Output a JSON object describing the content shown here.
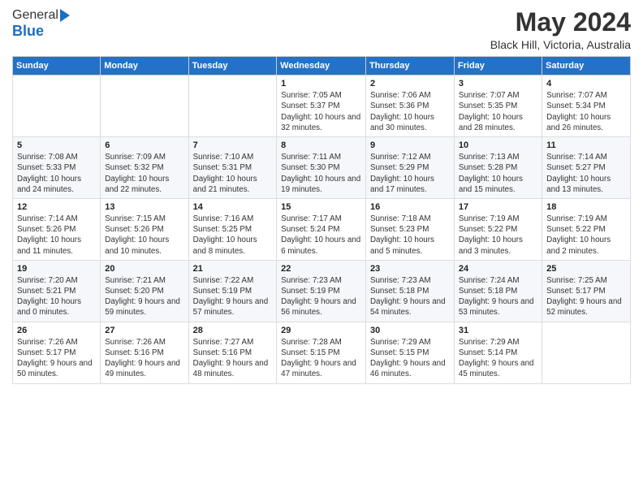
{
  "logo": {
    "general": "General",
    "blue": "Blue"
  },
  "header": {
    "month": "May 2024",
    "location": "Black Hill, Victoria, Australia"
  },
  "days_of_week": [
    "Sunday",
    "Monday",
    "Tuesday",
    "Wednesday",
    "Thursday",
    "Friday",
    "Saturday"
  ],
  "weeks": [
    [
      {
        "day": "",
        "info": ""
      },
      {
        "day": "",
        "info": ""
      },
      {
        "day": "",
        "info": ""
      },
      {
        "day": "1",
        "info": "Sunrise: 7:05 AM\nSunset: 5:37 PM\nDaylight: 10 hours and 32 minutes."
      },
      {
        "day": "2",
        "info": "Sunrise: 7:06 AM\nSunset: 5:36 PM\nDaylight: 10 hours and 30 minutes."
      },
      {
        "day": "3",
        "info": "Sunrise: 7:07 AM\nSunset: 5:35 PM\nDaylight: 10 hours and 28 minutes."
      },
      {
        "day": "4",
        "info": "Sunrise: 7:07 AM\nSunset: 5:34 PM\nDaylight: 10 hours and 26 minutes."
      }
    ],
    [
      {
        "day": "5",
        "info": "Sunrise: 7:08 AM\nSunset: 5:33 PM\nDaylight: 10 hours and 24 minutes."
      },
      {
        "day": "6",
        "info": "Sunrise: 7:09 AM\nSunset: 5:32 PM\nDaylight: 10 hours and 22 minutes."
      },
      {
        "day": "7",
        "info": "Sunrise: 7:10 AM\nSunset: 5:31 PM\nDaylight: 10 hours and 21 minutes."
      },
      {
        "day": "8",
        "info": "Sunrise: 7:11 AM\nSunset: 5:30 PM\nDaylight: 10 hours and 19 minutes."
      },
      {
        "day": "9",
        "info": "Sunrise: 7:12 AM\nSunset: 5:29 PM\nDaylight: 10 hours and 17 minutes."
      },
      {
        "day": "10",
        "info": "Sunrise: 7:13 AM\nSunset: 5:28 PM\nDaylight: 10 hours and 15 minutes."
      },
      {
        "day": "11",
        "info": "Sunrise: 7:14 AM\nSunset: 5:27 PM\nDaylight: 10 hours and 13 minutes."
      }
    ],
    [
      {
        "day": "12",
        "info": "Sunrise: 7:14 AM\nSunset: 5:26 PM\nDaylight: 10 hours and 11 minutes."
      },
      {
        "day": "13",
        "info": "Sunrise: 7:15 AM\nSunset: 5:26 PM\nDaylight: 10 hours and 10 minutes."
      },
      {
        "day": "14",
        "info": "Sunrise: 7:16 AM\nSunset: 5:25 PM\nDaylight: 10 hours and 8 minutes."
      },
      {
        "day": "15",
        "info": "Sunrise: 7:17 AM\nSunset: 5:24 PM\nDaylight: 10 hours and 6 minutes."
      },
      {
        "day": "16",
        "info": "Sunrise: 7:18 AM\nSunset: 5:23 PM\nDaylight: 10 hours and 5 minutes."
      },
      {
        "day": "17",
        "info": "Sunrise: 7:19 AM\nSunset: 5:22 PM\nDaylight: 10 hours and 3 minutes."
      },
      {
        "day": "18",
        "info": "Sunrise: 7:19 AM\nSunset: 5:22 PM\nDaylight: 10 hours and 2 minutes."
      }
    ],
    [
      {
        "day": "19",
        "info": "Sunrise: 7:20 AM\nSunset: 5:21 PM\nDaylight: 10 hours and 0 minutes."
      },
      {
        "day": "20",
        "info": "Sunrise: 7:21 AM\nSunset: 5:20 PM\nDaylight: 9 hours and 59 minutes."
      },
      {
        "day": "21",
        "info": "Sunrise: 7:22 AM\nSunset: 5:19 PM\nDaylight: 9 hours and 57 minutes."
      },
      {
        "day": "22",
        "info": "Sunrise: 7:23 AM\nSunset: 5:19 PM\nDaylight: 9 hours and 56 minutes."
      },
      {
        "day": "23",
        "info": "Sunrise: 7:23 AM\nSunset: 5:18 PM\nDaylight: 9 hours and 54 minutes."
      },
      {
        "day": "24",
        "info": "Sunrise: 7:24 AM\nSunset: 5:18 PM\nDaylight: 9 hours and 53 minutes."
      },
      {
        "day": "25",
        "info": "Sunrise: 7:25 AM\nSunset: 5:17 PM\nDaylight: 9 hours and 52 minutes."
      }
    ],
    [
      {
        "day": "26",
        "info": "Sunrise: 7:26 AM\nSunset: 5:17 PM\nDaylight: 9 hours and 50 minutes."
      },
      {
        "day": "27",
        "info": "Sunrise: 7:26 AM\nSunset: 5:16 PM\nDaylight: 9 hours and 49 minutes."
      },
      {
        "day": "28",
        "info": "Sunrise: 7:27 AM\nSunset: 5:16 PM\nDaylight: 9 hours and 48 minutes."
      },
      {
        "day": "29",
        "info": "Sunrise: 7:28 AM\nSunset: 5:15 PM\nDaylight: 9 hours and 47 minutes."
      },
      {
        "day": "30",
        "info": "Sunrise: 7:29 AM\nSunset: 5:15 PM\nDaylight: 9 hours and 46 minutes."
      },
      {
        "day": "31",
        "info": "Sunrise: 7:29 AM\nSunset: 5:14 PM\nDaylight: 9 hours and 45 minutes."
      },
      {
        "day": "",
        "info": ""
      }
    ]
  ]
}
